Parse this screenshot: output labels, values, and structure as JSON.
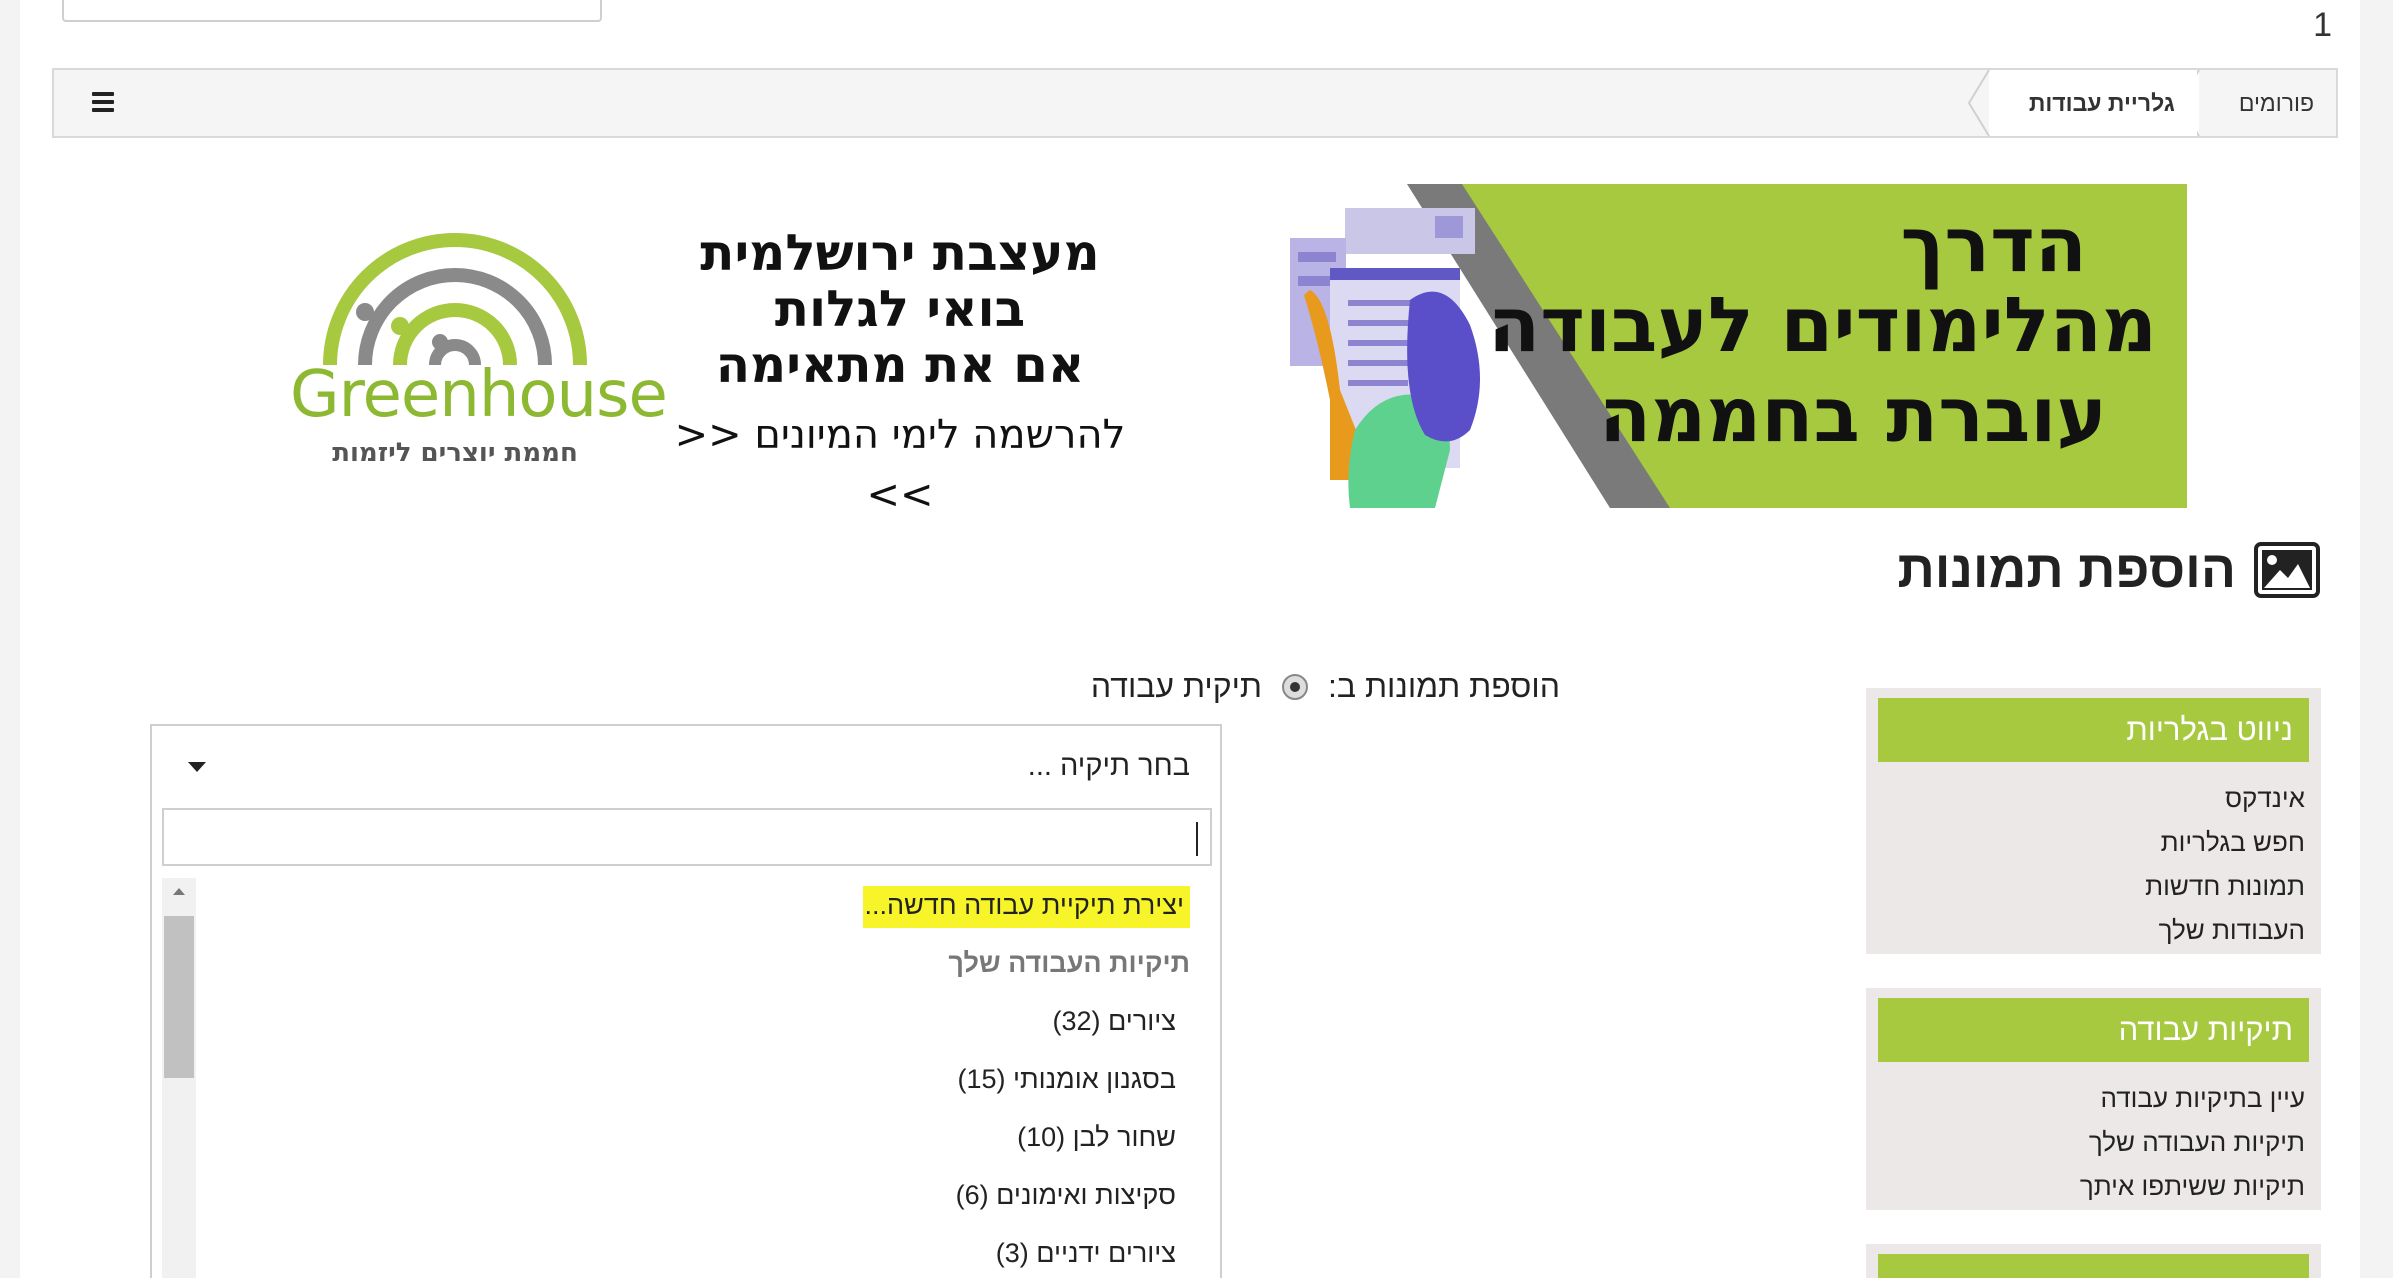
{
  "top": {
    "page_number": "1"
  },
  "breadcrumb": [
    {
      "label": "פורומים"
    },
    {
      "label": "גלריית עבודות"
    }
  ],
  "banner": {
    "headline": [
      "הדרך",
      "מהלימודים לעבודה",
      "עוברת בחממה"
    ],
    "promo": [
      "מעצבת ירושלמית",
      "בואי לגלות",
      "אם את מתאימה",
      ">> להרשמה לימי המיונים <<"
    ],
    "logo_word": "Greenhouse",
    "logo_sub": "חממת יוצרים ליזמות"
  },
  "heading": {
    "title": "הוספת תמונות"
  },
  "add_to": {
    "label": "הוספת תמונות ב:",
    "option": "תיקית עבודה"
  },
  "select": {
    "value": "בחר תיקיה ...",
    "create_option": "יצירת תיקיית עבודה חדשה...",
    "group_label": "תיקיות העבודה שלך",
    "options": [
      "ציורים (32)",
      "בסגנון אומנותי (15)",
      "שחור לבן (10)",
      "סקיצות ואימונים (6)",
      "ציורים ידניים (3)"
    ]
  },
  "sidebar": {
    "blocks": [
      {
        "title": "ניווט בגלריות",
        "links": [
          "אינדקס",
          "חפש בגלריות",
          "תמונות חדשות",
          "העבודות שלך"
        ]
      },
      {
        "title": "תיקיות עבודה",
        "links": [
          "עיין בתיקיות עבודה",
          "תיקיות העבודה שלך",
          "תיקיות ששיתפו איתך"
        ]
      }
    ]
  },
  "colors": {
    "accent_green": "#a7c940",
    "highlight": "#f7f52a"
  }
}
